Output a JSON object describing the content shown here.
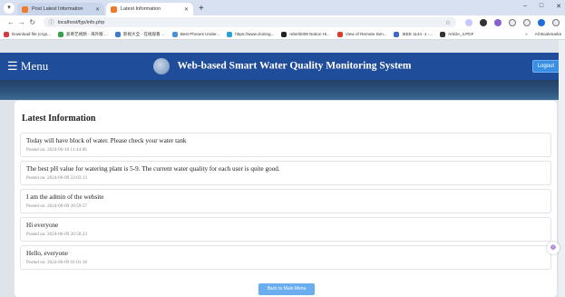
{
  "browser": {
    "tabs": [
      {
        "label": "Post Latest Information",
        "active": false
      },
      {
        "label": "Latest Information",
        "active": true
      }
    ],
    "new_tab": "+",
    "url": "localhost/fyp/info.php",
    "bookmarks": [
      {
        "label": "Download file (cryp...",
        "color": "#d23b3b"
      },
      {
        "label": "爱奇艺视频 - 海外版 ...",
        "color": "#3aa04a"
      },
      {
        "label": "影视大全 - 在线观看 ...",
        "color": "#3a7bd5"
      },
      {
        "label": "Best Phones Under...",
        "color": "#4a90d9"
      },
      {
        "label": "https://www.cloning...",
        "color": "#2aa0d8"
      },
      {
        "label": "rebel2009 Notion Hi...",
        "color": "#222222"
      },
      {
        "label": "View of Remote Sen...",
        "color": "#d8402a"
      },
      {
        "label": "IEEE 1144 -1 -...",
        "color": "#3a6ac4"
      },
      {
        "label": "Article_4.PDF",
        "color": "#333333"
      }
    ],
    "bookmarks_right": "All Bookmarks"
  },
  "header": {
    "menu_label": "☰ Menu",
    "title": "Web-based Smart Water Quality Monitoring System",
    "logout_label": "Logout"
  },
  "content": {
    "title": "Latest Information",
    "posts": [
      {
        "message": "Today will have block of water. Please check your water tank",
        "posted": "Posted on: 2024-06-10 11:44:06"
      },
      {
        "message": "The best pH value for watering plant is 5-9. The current water quality for each user is quite good.",
        "posted": "Posted on: 2024-06-09 23:03:13"
      },
      {
        "message": "I am the admin of the website",
        "posted": "Posted on: 2024-06-09 20:59:57"
      },
      {
        "message": "Hi everyone",
        "posted": "Posted on: 2024-06-09 20:58:23"
      },
      {
        "message": "Hello, everyone",
        "posted": "Posted on: 2024-06-09 01:01:18"
      }
    ],
    "back_label": "Back to Main Menu"
  },
  "colors": {
    "header_bg": "#1f4d9a",
    "button_blue": "#6aaef0",
    "logout_blue": "#3a8fe4"
  }
}
